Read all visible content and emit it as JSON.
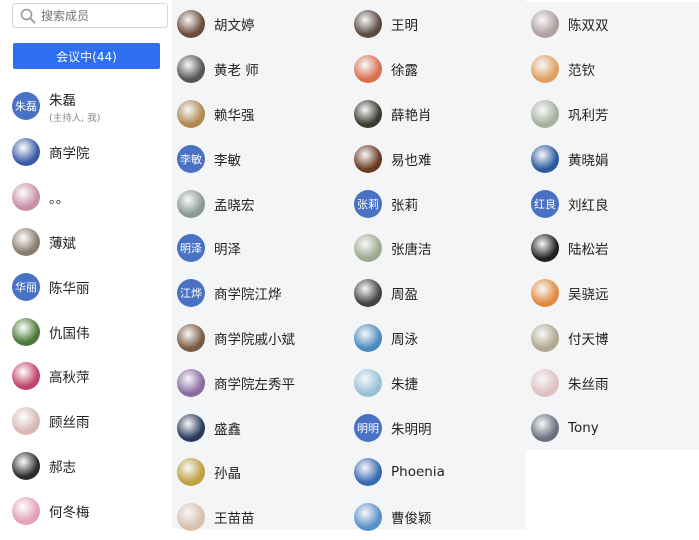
{
  "search": {
    "placeholder": "搜索成员",
    "icon": "search-icon"
  },
  "meeting_button": {
    "label": "会议中(44)"
  },
  "columns": [
    [
      {
        "name": "朱磊",
        "avatar_text": "朱磊",
        "sub": "(主持人, 我)",
        "avatar_type": "text"
      },
      {
        "name": "商学院",
        "avatar_type": "photo",
        "color": "#3b5aa8"
      },
      {
        "name": "。。",
        "avatar_type": "photo",
        "color": "#c98fa8"
      },
      {
        "name": "薄斌",
        "avatar_type": "photo",
        "color": "#8a7d6f"
      },
      {
        "name": "陈华丽",
        "avatar_text": "华丽",
        "avatar_type": "text"
      },
      {
        "name": "仇国伟",
        "avatar_type": "photo",
        "color": "#4c7a3a"
      },
      {
        "name": "高秋萍",
        "avatar_type": "photo",
        "color": "#c2446a"
      },
      {
        "name": "顾丝雨",
        "avatar_type": "photo",
        "color": "#d9b8b3"
      },
      {
        "name": "郝志",
        "avatar_type": "photo",
        "color": "#2c2c2c"
      },
      {
        "name": "何冬梅",
        "avatar_type": "photo",
        "color": "#e3a0b8"
      }
    ],
    [
      {
        "name": "胡文婷",
        "avatar_type": "photo",
        "color": "#6b4b3a"
      },
      {
        "name": "黄老  师",
        "avatar_type": "photo",
        "color": "#555555"
      },
      {
        "name": "赖华强",
        "avatar_type": "photo",
        "color": "#b08850"
      },
      {
        "name": "李敏",
        "avatar_text": "李敏",
        "avatar_type": "text"
      },
      {
        "name": "孟晓宏",
        "avatar_type": "photo",
        "color": "#8a9a90"
      },
      {
        "name": "明泽",
        "avatar_text": "明泽",
        "avatar_type": "text"
      },
      {
        "name": "商学院江烨",
        "avatar_text": "江烨",
        "avatar_type": "text"
      },
      {
        "name": "商学院戚小斌",
        "avatar_type": "photo",
        "color": "#7a5a40"
      },
      {
        "name": "商学院左秀平",
        "avatar_type": "photo",
        "color": "#8a6aa0"
      },
      {
        "name": "盛鑫",
        "avatar_type": "photo",
        "color": "#2a3a5a"
      },
      {
        "name": "孙晶",
        "avatar_type": "photo",
        "color": "#c0a040"
      },
      {
        "name": "王苗苗",
        "avatar_type": "photo",
        "color": "#d8c0b0"
      }
    ],
    [
      {
        "name": "王明",
        "avatar_type": "photo",
        "color": "#5a4a40"
      },
      {
        "name": "徐露",
        "avatar_type": "photo",
        "color": "#d87050"
      },
      {
        "name": "薛艳肖",
        "avatar_type": "photo",
        "color": "#3a3a30"
      },
      {
        "name": "易也难",
        "avatar_type": "photo",
        "color": "#6a3a20"
      },
      {
        "name": "张莉",
        "avatar_text": "张莉",
        "avatar_type": "text"
      },
      {
        "name": "张唐洁",
        "avatar_type": "photo",
        "color": "#a0a890"
      },
      {
        "name": "周盈",
        "avatar_type": "photo",
        "color": "#444444"
      },
      {
        "name": "周泳",
        "avatar_type": "photo",
        "color": "#4a8ac0"
      },
      {
        "name": "朱捷",
        "avatar_type": "photo",
        "color": "#9ac0d8"
      },
      {
        "name": "朱明明",
        "avatar_text": "明明",
        "avatar_type": "text"
      },
      {
        "name": "Phoenia",
        "avatar_type": "photo",
        "color": "#3a6ab0"
      },
      {
        "name": "曹俊颖",
        "avatar_type": "photo",
        "color": "#5a90c8"
      }
    ],
    [
      {
        "name": "陈双双",
        "avatar_type": "photo",
        "color": "#b0a0a0"
      },
      {
        "name": "范钦",
        "avatar_type": "photo",
        "color": "#e0a060"
      },
      {
        "name": "巩利芳",
        "avatar_type": "photo",
        "color": "#a8b0a0"
      },
      {
        "name": "黄晓娟",
        "avatar_type": "photo",
        "color": "#2a5aa0"
      },
      {
        "name": "刘红良",
        "avatar_text": "红良",
        "avatar_type": "text"
      },
      {
        "name": "陆松岩",
        "avatar_type": "photo",
        "color": "#222222"
      },
      {
        "name": "吴骁远",
        "avatar_type": "photo",
        "color": "#e08a40"
      },
      {
        "name": "付天博",
        "avatar_type": "photo",
        "color": "#b0a890"
      },
      {
        "name": "朱丝雨",
        "avatar_type": "photo",
        "color": "#e0c0c0"
      },
      {
        "name": "Tony",
        "avatar_type": "photo",
        "color": "#6a7080"
      }
    ]
  ]
}
